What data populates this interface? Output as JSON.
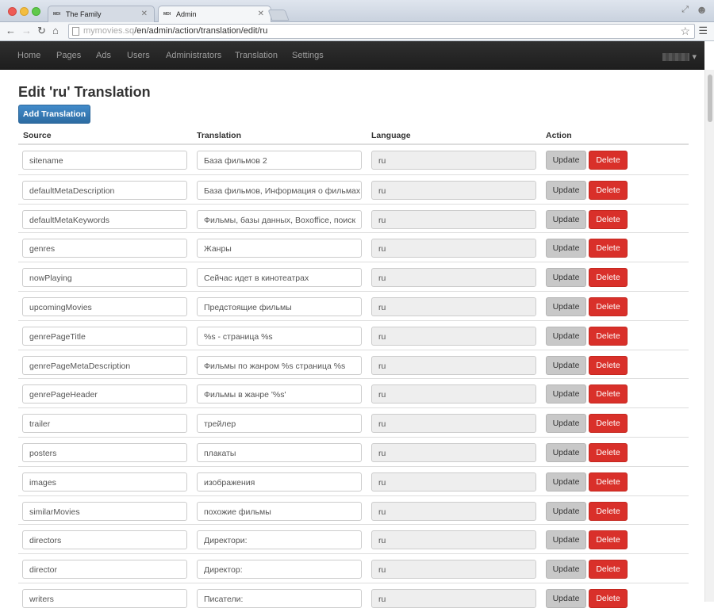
{
  "browser": {
    "tabs": [
      {
        "favicon": "MDI",
        "title": "The Family"
      },
      {
        "favicon": "MDI",
        "title": "Admin"
      }
    ],
    "url_domain": "mymovies.sq",
    "url_path": "/en/admin/action/translation/edit/ru"
  },
  "navbar": {
    "items": [
      "Home",
      "Pages",
      "Ads",
      "Users",
      "Administrators",
      "Translation",
      "Settings"
    ],
    "user_caret": "▾"
  },
  "page": {
    "title": "Edit 'ru' Translation",
    "add_button": "Add Translation",
    "columns": [
      "Source",
      "Translation",
      "Language",
      "Action"
    ],
    "update_label": "Update",
    "delete_label": "Delete"
  },
  "rows": [
    {
      "source": "sitename",
      "translation": "База фильмов 2",
      "language": "ru"
    },
    {
      "source": "defaultMetaDescription",
      "translation": "База фильмов, Информация о фильмах",
      "language": "ru"
    },
    {
      "source": "defaultMetaKeywords",
      "translation": "Фильмы, базы данных, Boxoffice, поиск",
      "language": "ru"
    },
    {
      "source": "genres",
      "translation": "Жанры",
      "language": "ru"
    },
    {
      "source": "nowPlaying",
      "translation": "Сейчас идет в кинотеатрах",
      "language": "ru"
    },
    {
      "source": "upcomingMovies",
      "translation": "Предстоящие фильмы",
      "language": "ru"
    },
    {
      "source": "genrePageTitle",
      "translation": "%s - страница %s",
      "language": "ru"
    },
    {
      "source": "genrePageMetaDescription",
      "translation": "Фильмы по жанром %s страница %s",
      "language": "ru"
    },
    {
      "source": "genrePageHeader",
      "translation": "Фильмы в жанре '%s'",
      "language": "ru"
    },
    {
      "source": "trailer",
      "translation": "трейлер",
      "language": "ru"
    },
    {
      "source": "posters",
      "translation": "плакаты",
      "language": "ru"
    },
    {
      "source": "images",
      "translation": "изображения",
      "language": "ru"
    },
    {
      "source": "similarMovies",
      "translation": "похожие фильмы",
      "language": "ru"
    },
    {
      "source": "directors",
      "translation": "Директори:",
      "language": "ru"
    },
    {
      "source": "director",
      "translation": "Директор:",
      "language": "ru"
    },
    {
      "source": "writers",
      "translation": "Писатели:",
      "language": "ru"
    }
  ]
}
